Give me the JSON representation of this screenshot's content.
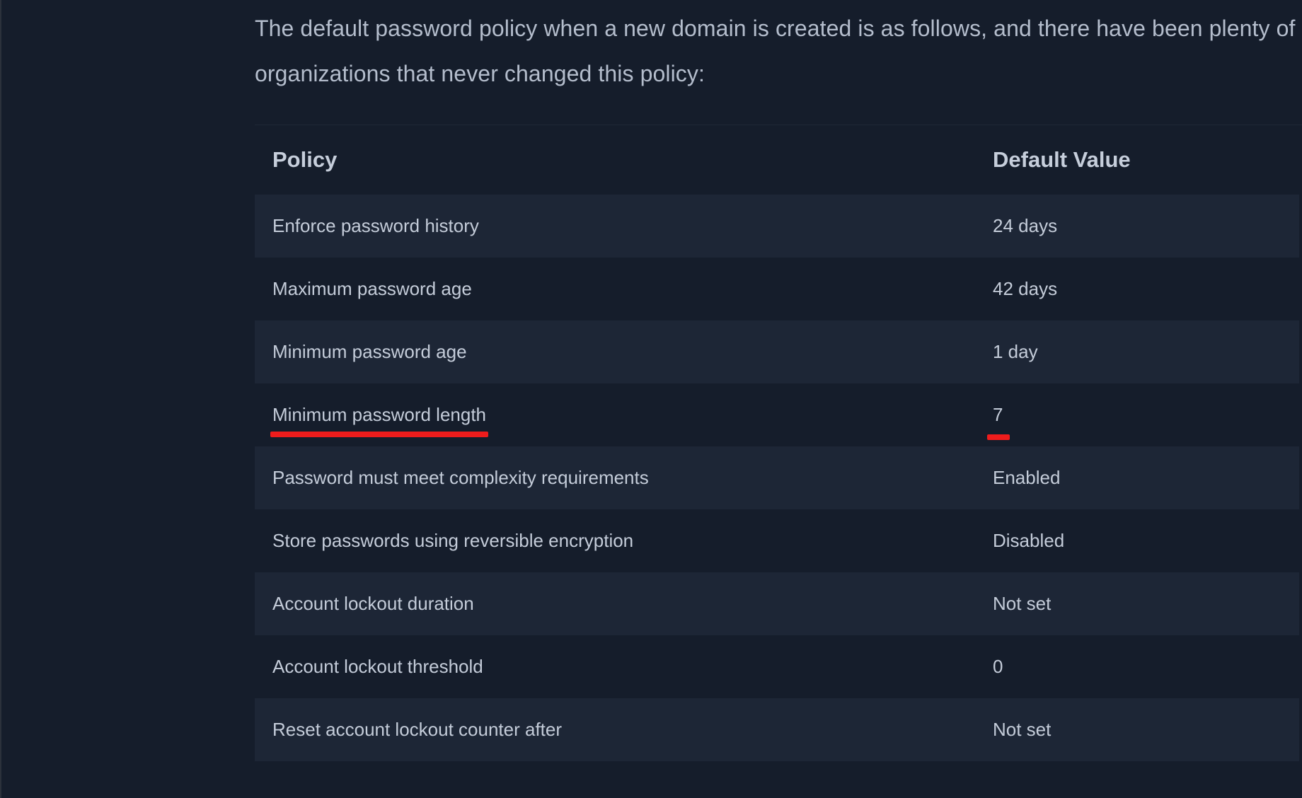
{
  "intro_text": "The default password policy when a new domain is created is as follows, and there have been plenty of organizations that never changed this policy:",
  "table": {
    "headers": {
      "policy": "Policy",
      "value": "Default Value"
    },
    "rows": [
      {
        "policy": "Enforce password history",
        "value": "24 days"
      },
      {
        "policy": "Maximum password age",
        "value": "42 days"
      },
      {
        "policy": "Minimum password age",
        "value": "1 day"
      },
      {
        "policy": "Minimum password length",
        "value": "7"
      },
      {
        "policy": "Password must meet complexity requirements",
        "value": "Enabled"
      },
      {
        "policy": "Store passwords using reversible encryption",
        "value": "Disabled"
      },
      {
        "policy": "Account lockout duration",
        "value": "Not set"
      },
      {
        "policy": "Account lockout threshold",
        "value": "0"
      },
      {
        "policy": "Reset account lockout counter after",
        "value": "Not set"
      }
    ]
  },
  "highlight_color": "#ee1c1c",
  "background_color": "#151d2b",
  "shaded_row_color": "#1d2636"
}
